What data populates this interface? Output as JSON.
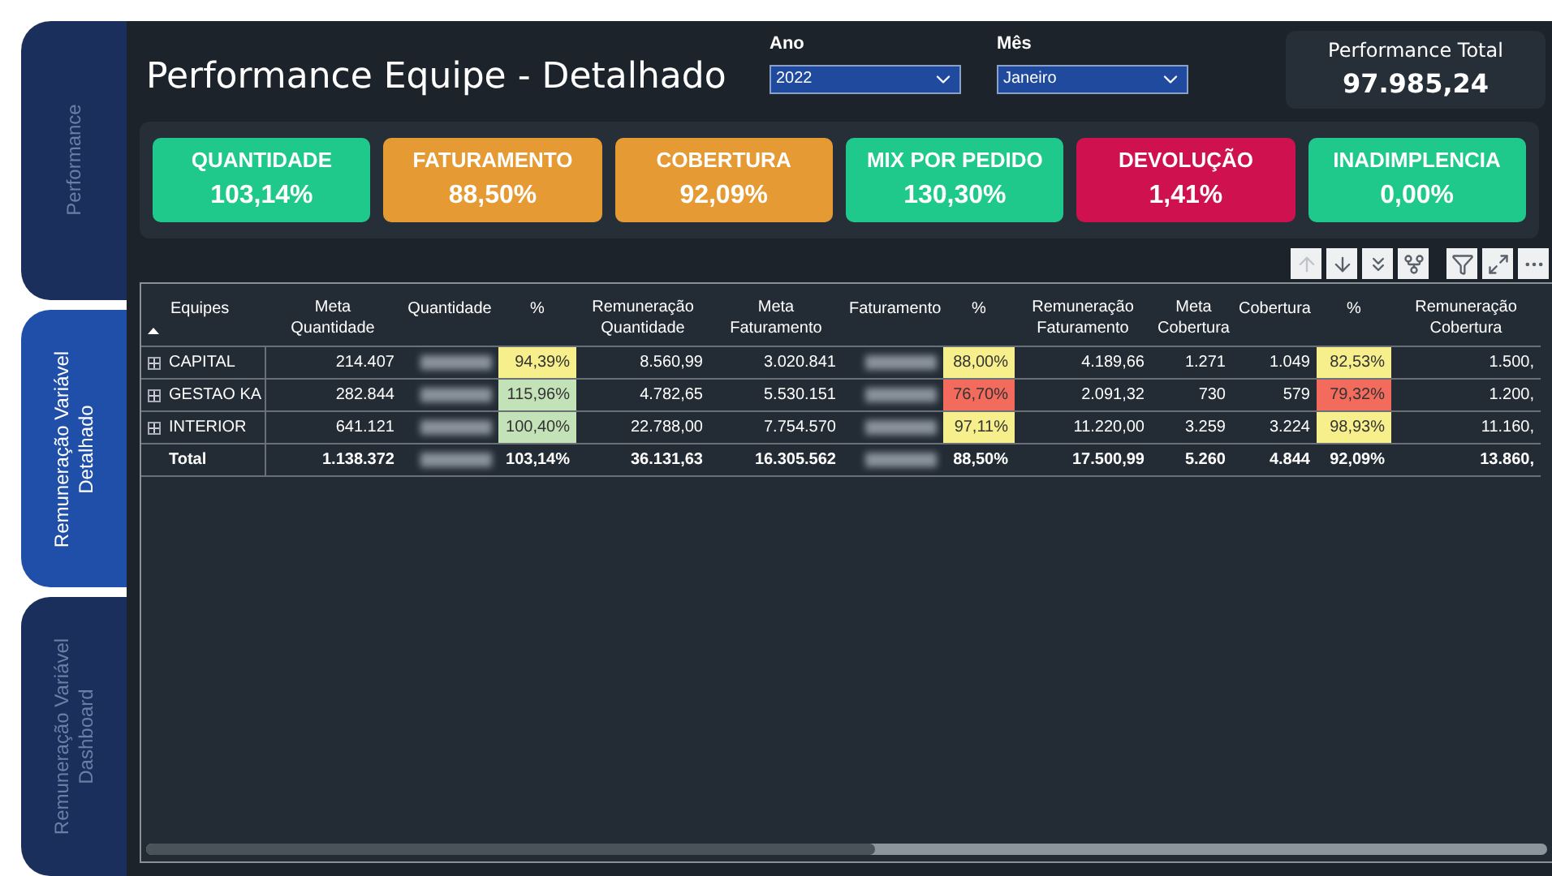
{
  "tabs": [
    {
      "label": "Performance",
      "selected": false
    },
    {
      "label": "Remuneração Variável Detalhado",
      "selected": true
    },
    {
      "label": "Remuneração Variável Dashboard",
      "selected": false
    }
  ],
  "title": "Performance Equipe - Detalhado",
  "slicers": [
    {
      "label": "Ano",
      "value": "2022"
    },
    {
      "label": "Mês",
      "value": "Janeiro"
    }
  ],
  "total_card": {
    "label": "Performance Total",
    "value": "97.985,24"
  },
  "kpis": [
    {
      "label": "QUANTIDADE",
      "value": "103,14%",
      "color": "#1fc98b"
    },
    {
      "label": "FATURAMENTO",
      "value": "88,50%",
      "color": "#e69a33"
    },
    {
      "label": "COBERTURA",
      "value": "92,09%",
      "color": "#e69a33"
    },
    {
      "label": "MIX POR PEDIDO",
      "value": "130,30%",
      "color": "#1fc98b"
    },
    {
      "label": "DEVOLUÇÃO",
      "value": "1,41%",
      "color": "#cf1150"
    },
    {
      "label": "INADIMPLENCIA",
      "value": "0,00%",
      "color": "#1fc98b"
    }
  ],
  "toolbar": [
    {
      "kind": "up",
      "disabled": true
    },
    {
      "kind": "down",
      "disabled": false
    },
    {
      "kind": "expand-all",
      "disabled": false
    },
    {
      "kind": "hierarchy",
      "disabled": false
    },
    {
      "kind": "filter",
      "disabled": false
    },
    {
      "kind": "focus",
      "disabled": false
    },
    {
      "kind": "more",
      "disabled": false
    }
  ],
  "table": {
    "columns": [
      "Equipes",
      "Meta Quantidade",
      "Quantidade",
      "%",
      "Remuneração Quantidade",
      "Meta Faturamento",
      "Faturamento",
      "%",
      "Remuneração Faturamento",
      "Meta Cobertura",
      "Cobertura",
      "%",
      "Remuneração Cobertura"
    ],
    "rows": [
      {
        "kind": "group",
        "cells": [
          {
            "text": "CAPITAL"
          },
          {
            "text": "214.407"
          },
          {
            "kind": "blurred"
          },
          {
            "text": "94,39%",
            "color": "#f7ef8b"
          },
          {
            "text": "8.560,99"
          },
          {
            "text": "3.020.841"
          },
          {
            "kind": "blurred"
          },
          {
            "text": "88,00%",
            "color": "#f7ef8b"
          },
          {
            "text": "4.189,66"
          },
          {
            "text": "1.271"
          },
          {
            "text": "1.049"
          },
          {
            "text": "82,53%",
            "color": "#f7ef8b"
          },
          {
            "text": "1.500,"
          }
        ]
      },
      {
        "kind": "group",
        "cells": [
          {
            "text": "GESTAO KA"
          },
          {
            "text": "282.844"
          },
          {
            "kind": "blurred"
          },
          {
            "text": "115,96%",
            "color": "#c4e2b8"
          },
          {
            "text": "4.782,65"
          },
          {
            "text": "5.530.151"
          },
          {
            "kind": "blurred"
          },
          {
            "text": "76,70%",
            "color": "#f26b5d"
          },
          {
            "text": "2.091,32"
          },
          {
            "text": "730"
          },
          {
            "text": "579"
          },
          {
            "text": "79,32%",
            "color": "#f26b5d"
          },
          {
            "text": "1.200,"
          }
        ]
      },
      {
        "kind": "group",
        "cells": [
          {
            "text": "INTERIOR"
          },
          {
            "text": "641.121"
          },
          {
            "kind": "blurred"
          },
          {
            "text": "100,40%",
            "color": "#c4e2b8"
          },
          {
            "text": "22.788,00"
          },
          {
            "text": "7.754.570"
          },
          {
            "kind": "blurred"
          },
          {
            "text": "97,11%",
            "color": "#f7ef8b"
          },
          {
            "text": "11.220,00"
          },
          {
            "text": "3.259"
          },
          {
            "text": "3.224"
          },
          {
            "text": "98,93%",
            "color": "#f7ef8b"
          },
          {
            "text": "11.160,"
          }
        ]
      },
      {
        "kind": "total",
        "cells": [
          {
            "text": "Total"
          },
          {
            "text": "1.138.372"
          },
          {
            "kind": "blurred"
          },
          {
            "text": "103,14%"
          },
          {
            "text": "36.131,63"
          },
          {
            "text": "16.305.562"
          },
          {
            "kind": "blurred"
          },
          {
            "text": "88,50%"
          },
          {
            "text": "17.500,99"
          },
          {
            "text": "5.260"
          },
          {
            "text": "4.844"
          },
          {
            "text": "92,09%"
          },
          {
            "text": "13.860,"
          }
        ]
      }
    ]
  }
}
